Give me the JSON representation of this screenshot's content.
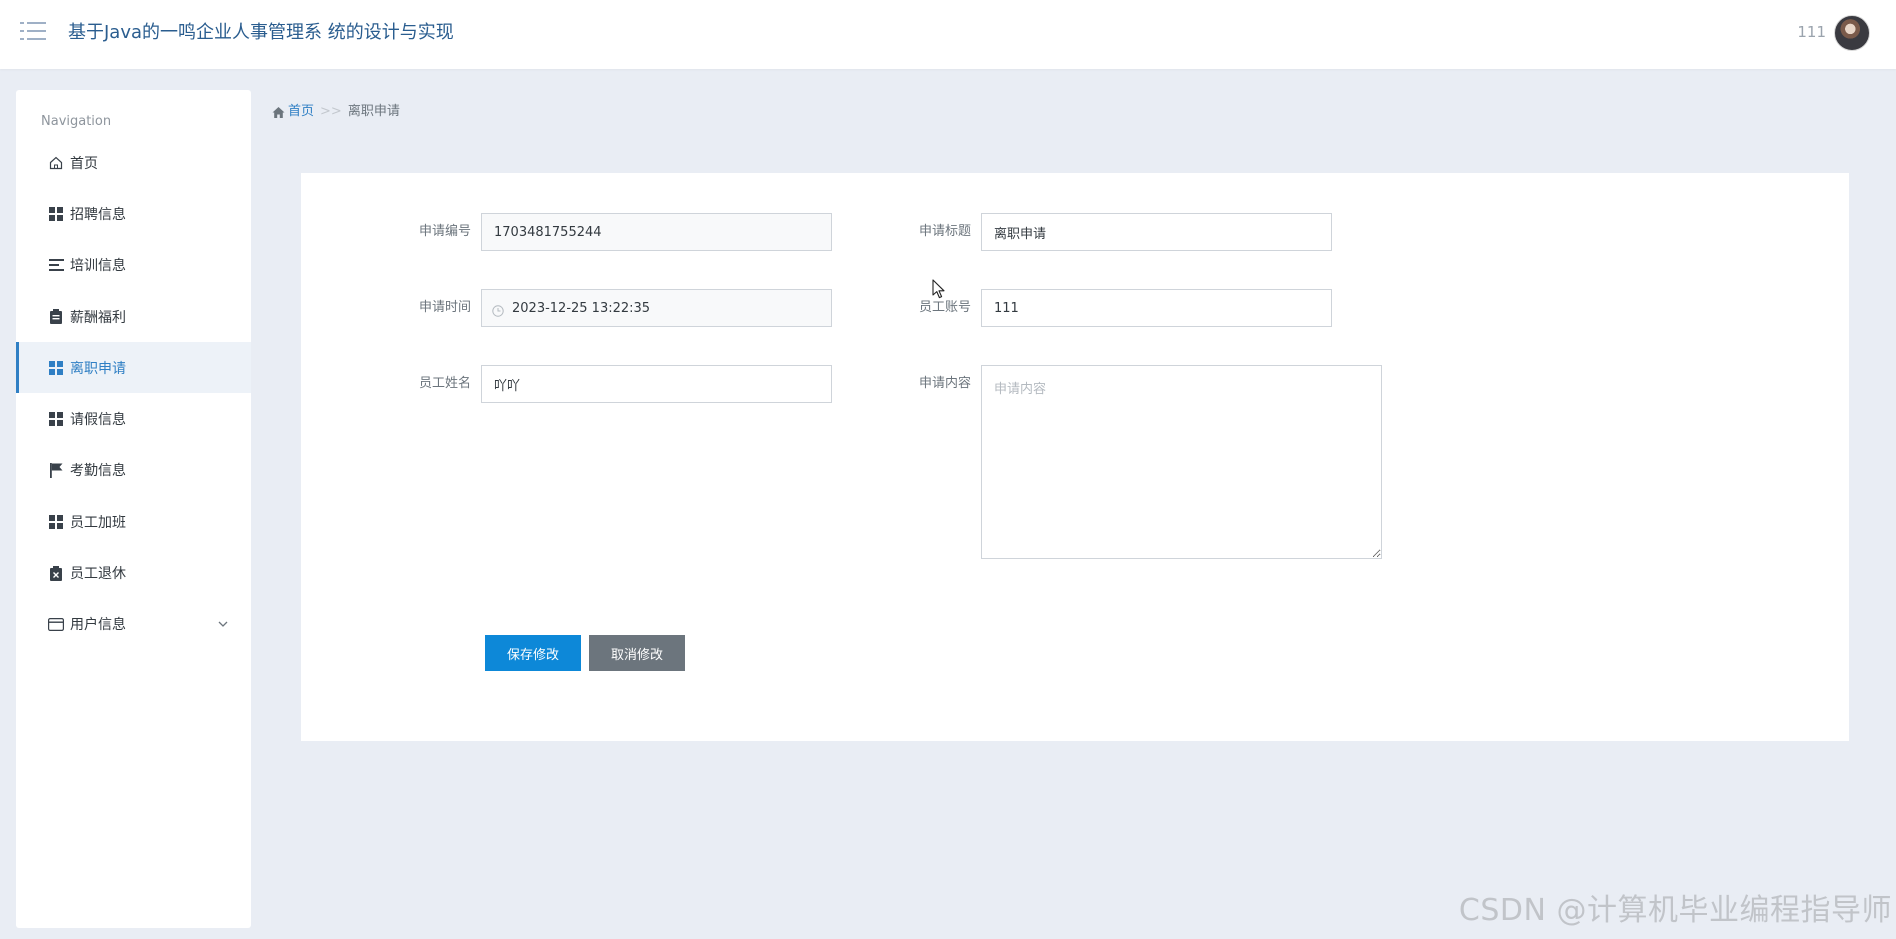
{
  "header": {
    "title": "基于Java的一鸣企业人事管理系 统的设计与实现",
    "user_name": "111",
    "menu_icon": "list-menu-icon",
    "title_color": "#2a5d8f"
  },
  "sidebar": {
    "nav_title": "Navigation",
    "active_color": "#2f7fc4",
    "items": [
      {
        "label": "首页",
        "icon": "home-icon"
      },
      {
        "label": "招聘信息",
        "icon": "grid-icon"
      },
      {
        "label": "培训信息",
        "icon": "list-lines-icon"
      },
      {
        "label": "薪酬福利",
        "icon": "clipboard-icon"
      },
      {
        "label": "离职申请",
        "icon": "grid-icon",
        "active": true
      },
      {
        "label": "请假信息",
        "icon": "grid-icon"
      },
      {
        "label": "考勤信息",
        "icon": "flag-icon"
      },
      {
        "label": "员工加班",
        "icon": "grid-icon"
      },
      {
        "label": "员工退休",
        "icon": "clipboard-x-icon"
      },
      {
        "label": "用户信息",
        "icon": "wallet-icon",
        "expandable": true
      }
    ]
  },
  "breadcrumb": {
    "home": "首页",
    "separator": ">>",
    "current": "离职申请"
  },
  "form": {
    "apply_no": {
      "label": "申请编号",
      "value": "1703481755244"
    },
    "apply_title": {
      "label": "申请标题",
      "value": "离职申请"
    },
    "apply_time": {
      "label": "申请时间",
      "value": "2023-12-25 13:22:35"
    },
    "employee_account": {
      "label": "员工账号",
      "value": "111"
    },
    "employee_name": {
      "label": "员工姓名",
      "value": "吖吖"
    },
    "apply_content": {
      "label": "申请内容",
      "placeholder": "申请内容",
      "value": ""
    },
    "save_label": "保存修改",
    "cancel_label": "取消修改",
    "save_color": "#0d88d8",
    "cancel_color": "#6c757d"
  },
  "watermark": "CSDN @计算机毕业编程指导师"
}
